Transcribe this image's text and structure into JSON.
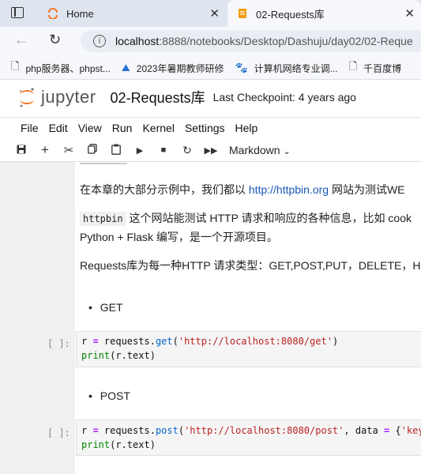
{
  "browser": {
    "tabs": [
      {
        "title": "Home",
        "icon": "jupyter-tab-icon"
      },
      {
        "title": "02-Requests库",
        "icon": "notebook-tab-icon"
      }
    ],
    "url_host": "localhost",
    "url_rest": ":8888/notebooks/Desktop/Dashuju/day02/02-Reque",
    "bookmarks": [
      {
        "label": "php服务器、phpst...",
        "icon": "page-icon"
      },
      {
        "label": "2023年暑期教师研修",
        "icon": "course-icon"
      },
      {
        "label": "计算机网络专业调...",
        "icon": "paw-icon"
      },
      {
        "label": "千百度博",
        "icon": "page-icon"
      }
    ]
  },
  "jupyter": {
    "logo_text": "jupyter",
    "notebook_title": "02-Requests库",
    "checkpoint": "Last Checkpoint: 4 years ago",
    "menu": [
      "File",
      "Edit",
      "View",
      "Run",
      "Kernel",
      "Settings",
      "Help"
    ],
    "cell_type": "Markdown"
  },
  "cells": {
    "p1_before": "在本章的大部分示例中，我们都以 ",
    "p1_link": "http://httpbin.org",
    "p1_after": " 网站为测试WE",
    "p2_code": "httpbin",
    "p2_text": "这个网站能测试 HTTP 请求和响应的各种信息，比如 cook",
    "p2_line2": "Python + Flask 编写，是一个开源项目。",
    "p3": "Requests库为每一种HTTP 请求类型：GET,POST,PUT，DELETE，HE",
    "bullet_get": "GET",
    "prompt": "[ ]:",
    "code_get": {
      "a": "r ",
      "eq": "=",
      "b": " requests.",
      "fn": "get",
      "c": "(",
      "str": "'http://localhost:8080/get'",
      "d": ")",
      "line2_fn": "print",
      "line2_rest": "(r.text)"
    },
    "bullet_post": "POST",
    "code_post": {
      "a": "r ",
      "eq": "=",
      "b": " requests.",
      "fn": "post",
      "c": "(",
      "str": "'http://localhost:8080/post'",
      "d": ", data ",
      "eq2": "=",
      "e": " {",
      "str2": "'key",
      "line2_fn": "print",
      "line2_rest": "(r.text)"
    }
  }
}
